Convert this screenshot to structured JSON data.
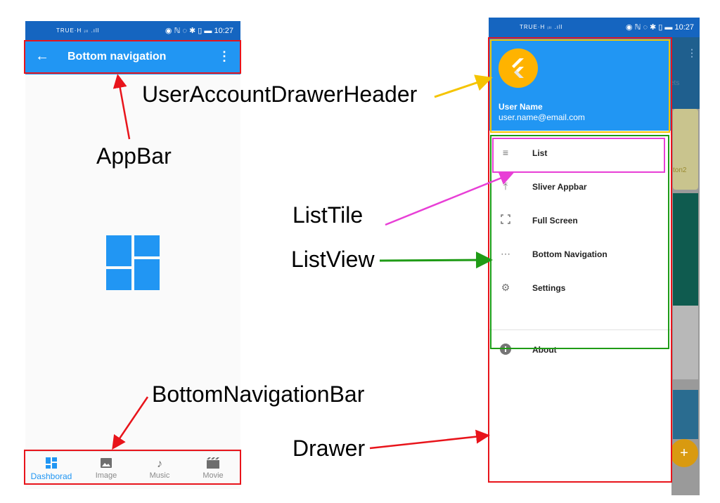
{
  "left_phone": {
    "status_left": "TRUE·H ᵢₗₗ .ıll",
    "status_right": "◉ ℕ ◌ ✱ ▯ ▬ 10:27",
    "appbar": {
      "back_icon": "arrow-back-icon",
      "title": "Bottom navigation",
      "more_icon": "more-vert-icon"
    },
    "center_icon": "dashboard-icon",
    "bottom_nav": [
      {
        "label": "Dashborad",
        "icon": "dashboard-icon",
        "active": true
      },
      {
        "label": "Image",
        "icon": "image-icon",
        "active": false
      },
      {
        "label": "Music",
        "icon": "music-note-icon",
        "active": false
      },
      {
        "label": "Movie",
        "icon": "movie-icon",
        "active": false
      }
    ]
  },
  "right_phone": {
    "status_left": "TRUE·H ᵢₗₗ .ıll",
    "status_right": "◉ ℕ ◌ ✱ ▯ ▬ 10:27",
    "background_ghost_text": [
      "ets",
      "ton2"
    ],
    "fab_label": "+",
    "drawer": {
      "header": {
        "logo_icon": "flutter-logo-icon",
        "user_name": "User Name",
        "user_email": "user.name@email.com"
      },
      "items": [
        {
          "label": "List",
          "icon": "list-icon"
        },
        {
          "label": "Sliver Appbar",
          "icon": "vertical-align-top-icon"
        },
        {
          "label": "Full Screen",
          "icon": "fullscreen-icon"
        },
        {
          "label": "Bottom Navigation",
          "icon": "more-horiz-icon"
        },
        {
          "label": "Settings",
          "icon": "settings-icon"
        },
        {
          "label": "About",
          "icon": "info-icon"
        }
      ]
    }
  },
  "annotations": {
    "appbar": "AppBar",
    "user_account_drawer_header": "UserAccountDrawerHeader",
    "list_tile": "ListTile",
    "list_view": "ListView",
    "bottom_navigation_bar": "BottomNavigationBar",
    "drawer": "Drawer"
  },
  "colors": {
    "appbar_blue": "#2196f3",
    "status_blue": "#1565c0",
    "appbar_annotation": "#e8141b",
    "header_annotation": "#f5c400",
    "list_tile_annotation": "#e83fd6",
    "list_view_annotation": "#1f9b16",
    "drawer_annotation": "#e8141b"
  }
}
